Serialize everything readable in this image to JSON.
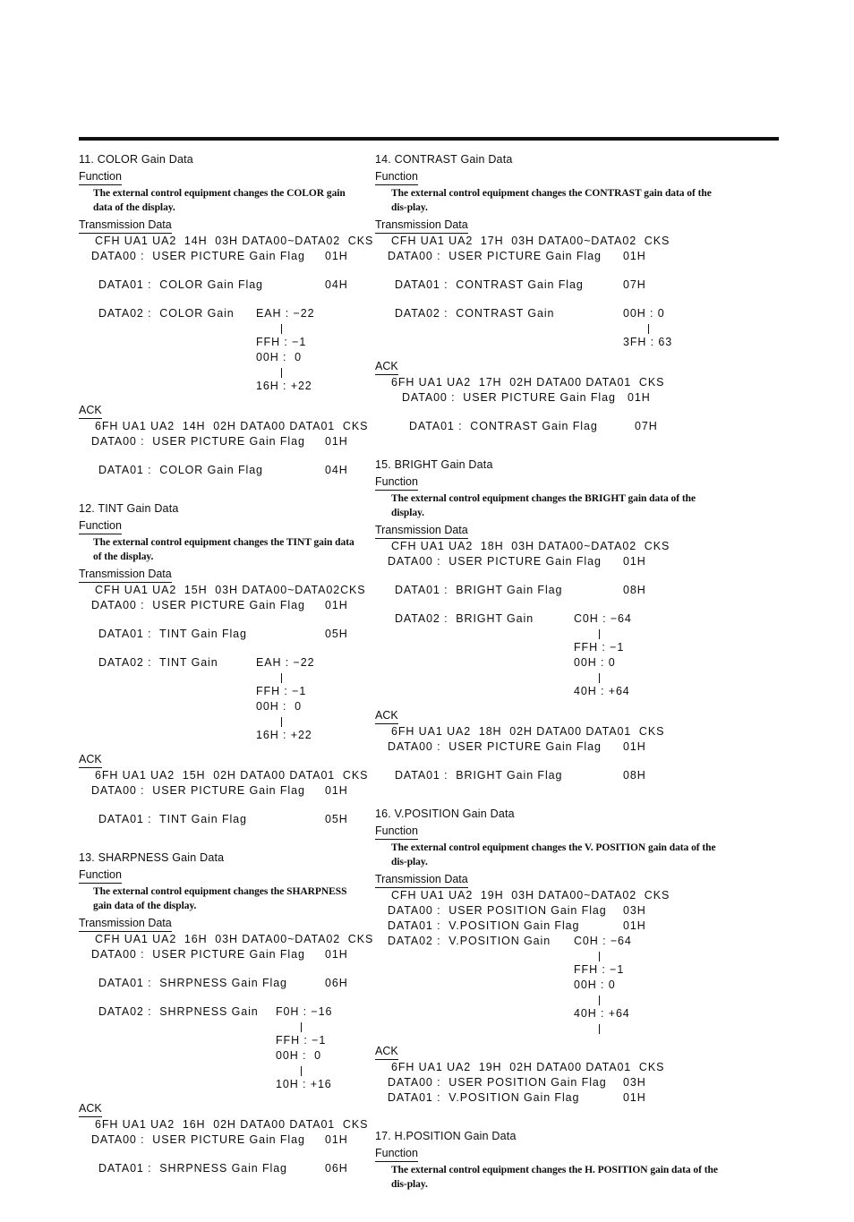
{
  "document": {
    "type": "service-manual-page",
    "rule_color": "#101010",
    "background": "#ffffff"
  },
  "left_column": {
    "sections": [
      {
        "number": "11.",
        "title": "11. COLOR Gain Data",
        "function_head": "Function",
        "function_text": "The external control equipment changes the COLOR gain data of the display.",
        "transmission_head": "Transmission Data",
        "transmission_frame": "CFH UA1 UA2  14H  03H DATA00~DATA02  CKS",
        "tx_fields": [
          {
            "label": "DATA00 :  USER PICTURE Gain Flag",
            "value": "01H"
          },
          {
            "label": "DATA01 :  COLOR Gain Flag",
            "value": "04H"
          },
          {
            "label": "DATA02 :  COLOR Gain",
            "value": ""
          }
        ],
        "range": [
          "EAH : −22",
          "FFH : −1",
          "00H :  0",
          "16H : +22"
        ],
        "ack_head": "ACK",
        "ack_frame": "6FH UA1 UA2  14H  02H DATA00 DATA01  CKS",
        "ack_fields": [
          {
            "label": "DATA00 :  USER PICTURE Gain Flag",
            "value": "01H"
          },
          {
            "label": "DATA01 :  COLOR Gain Flag",
            "value": "04H"
          }
        ]
      },
      {
        "number": "12.",
        "title": "12. TINT Gain Data",
        "function_head": "Function",
        "function_text": "The external control equipment changes the TINT gain data of the display.",
        "transmission_head": "Transmission Data",
        "transmission_frame": "CFH UA1 UA2  15H  03H DATA00~DATA02CKS",
        "tx_fields": [
          {
            "label": "DATA00 :  USER PICTURE Gain Flag",
            "value": "01H"
          },
          {
            "label": "DATA01 :  TINT Gain Flag",
            "value": "05H"
          },
          {
            "label": "DATA02 :  TINT Gain",
            "value": ""
          }
        ],
        "range": [
          "EAH : −22",
          "FFH : −1",
          "00H :  0",
          "16H : +22"
        ],
        "ack_head": "ACK",
        "ack_frame": "6FH UA1 UA2  15H  02H DATA00 DATA01  CKS",
        "ack_fields": [
          {
            "label": "DATA00 :  USER PICTURE Gain Flag",
            "value": "01H"
          },
          {
            "label": "DATA01 :  TINT Gain Flag",
            "value": "05H"
          }
        ]
      },
      {
        "number": "13.",
        "title": "13. SHARPNESS Gain Data",
        "function_head": "Function",
        "function_text": "The external control equipment changes the SHARPNESS gain data of the display.",
        "transmission_head": "Transmission Data",
        "transmission_frame": "CFH UA1 UA2  16H  03H DATA00~DATA02  CKS",
        "tx_fields": [
          {
            "label": "DATA00 :  USER PICTURE Gain Flag",
            "value": "01H"
          },
          {
            "label": "DATA01 :  SHRPNESS Gain Flag",
            "value": "06H"
          },
          {
            "label": "DATA02 :  SHRPNESS Gain",
            "value": ""
          }
        ],
        "range": [
          "F0H : −16",
          "FFH : −1",
          "00H :  0",
          "10H : +16"
        ],
        "ack_head": "ACK",
        "ack_frame": "6FH UA1 UA2  16H  02H DATA00 DATA01  CKS",
        "ack_fields": [
          {
            "label": "DATA00 :  USER PICTURE Gain Flag",
            "value": "01H"
          },
          {
            "label": "DATA01 :  SHRPNESS Gain Flag",
            "value": "06H"
          }
        ]
      }
    ]
  },
  "right_column": {
    "sections": [
      {
        "number": "14.",
        "title": "14. CONTRAST Gain Data",
        "function_head": "Function",
        "function_text": "The external control equipment changes the CONTRAST gain data of the dis-play.",
        "transmission_head": "Transmission Data",
        "transmission_frame": "CFH UA1 UA2  17H  03H DATA00~DATA02  CKS",
        "tx_fields": [
          {
            "label": "DATA00 :  USER PICTURE Gain Flag",
            "value": "01H"
          },
          {
            "label": "DATA01 :  CONTRAST Gain Flag",
            "value": "07H"
          },
          {
            "label": "DATA02 :  CONTRAST Gain",
            "value": ""
          }
        ],
        "range": [
          "00H : 0",
          "3FH : 63"
        ],
        "ack_head": "ACK",
        "ack_frame": "6FH UA1 UA2  17H  02H DATA00 DATA01  CKS",
        "ack_fields": [
          {
            "label": "DATA00 :  USER PICTURE Gain Flag",
            "value": "01H"
          },
          {
            "label": "DATA01 :  CONTRAST Gain Flag",
            "value": "07H"
          }
        ]
      },
      {
        "number": "15.",
        "title": "15. BRIGHT Gain Data",
        "function_head": "Function",
        "function_text": "The external control equipment changes the BRIGHT gain data of the display.",
        "transmission_head": "Transmission Data",
        "transmission_frame": "CFH UA1 UA2  18H  03H DATA00~DATA02  CKS",
        "tx_fields": [
          {
            "label": "DATA00 :  USER PICTURE Gain Flag",
            "value": "01H"
          },
          {
            "label": "DATA01 :  BRIGHT Gain Flag",
            "value": "08H"
          },
          {
            "label": "DATA02 :  BRIGHT Gain",
            "value": ""
          }
        ],
        "range": [
          "C0H : −64",
          "FFH : −1",
          "00H : 0",
          "40H : +64"
        ],
        "ack_head": "ACK",
        "ack_frame": "6FH UA1 UA2  18H  02H DATA00 DATA01  CKS",
        "ack_fields": [
          {
            "label": "DATA00 :  USER PICTURE Gain Flag",
            "value": "01H"
          },
          {
            "label": "DATA01 :  BRIGHT Gain Flag",
            "value": "08H"
          }
        ]
      },
      {
        "number": "16.",
        "title": "16. V.POSITION Gain Data",
        "function_head": "Function",
        "function_text": "The external control equipment changes the V. POSITION gain data of the dis-play.",
        "transmission_head": "Transmission Data",
        "transmission_frame": "CFH UA1 UA2  19H  03H DATA00~DATA02  CKS",
        "tx_fields": [
          {
            "label": "DATA00 :  USER POSITION Gain Flag",
            "value": "03H"
          },
          {
            "label": "DATA01 :  V.POSITION Gain Flag",
            "value": "01H"
          },
          {
            "label": "DATA02 :  V.POSITION Gain",
            "value": ""
          }
        ],
        "range": [
          "C0H : −64",
          "FFH : −1",
          "00H : 0",
          "40H : +64"
        ],
        "ack_head": "ACK",
        "ack_frame": "6FH UA1 UA2  19H  02H DATA00 DATA01  CKS",
        "ack_fields": [
          {
            "label": "DATA00 :  USER POSITION Gain Flag",
            "value": "03H"
          },
          {
            "label": "DATA01 :  V.POSITION Gain Flag",
            "value": "01H"
          }
        ]
      },
      {
        "number": "17.",
        "title": "17. H.POSITION Gain Data",
        "function_head": "Function",
        "function_text": "The external control equipment changes the H. POSITION gain data of the dis-play.",
        "transmission_head": "",
        "transmission_frame": "",
        "tx_fields": [],
        "range": [],
        "ack_head": "",
        "ack_frame": "",
        "ack_fields": []
      }
    ]
  }
}
